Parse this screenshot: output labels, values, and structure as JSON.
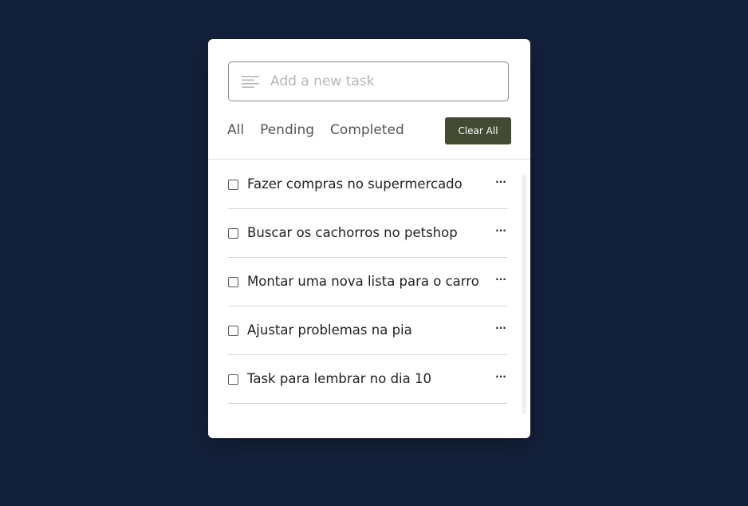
{
  "input": {
    "placeholder": "Add a new task",
    "value": ""
  },
  "filters": [
    {
      "label": "All"
    },
    {
      "label": "Pending"
    },
    {
      "label": "Completed"
    }
  ],
  "clear_all_label": "Clear All",
  "tasks": [
    {
      "text": "Fazer compras no supermercado",
      "checked": false
    },
    {
      "text": "Buscar os cachorros no petshop",
      "checked": false
    },
    {
      "text": "Montar uma nova lista para o carro",
      "checked": false
    },
    {
      "text": "Ajustar problemas na pia",
      "checked": false
    },
    {
      "text": "Task para lembrar no dia 10",
      "checked": false
    }
  ],
  "task_menu_glyph": "···",
  "colors": {
    "background": "#13203a",
    "card": "#ffffff",
    "button": "#434b33"
  },
  "icons": {
    "input": "text-lines-icon",
    "task_menu": "more-horizontal-icon"
  }
}
